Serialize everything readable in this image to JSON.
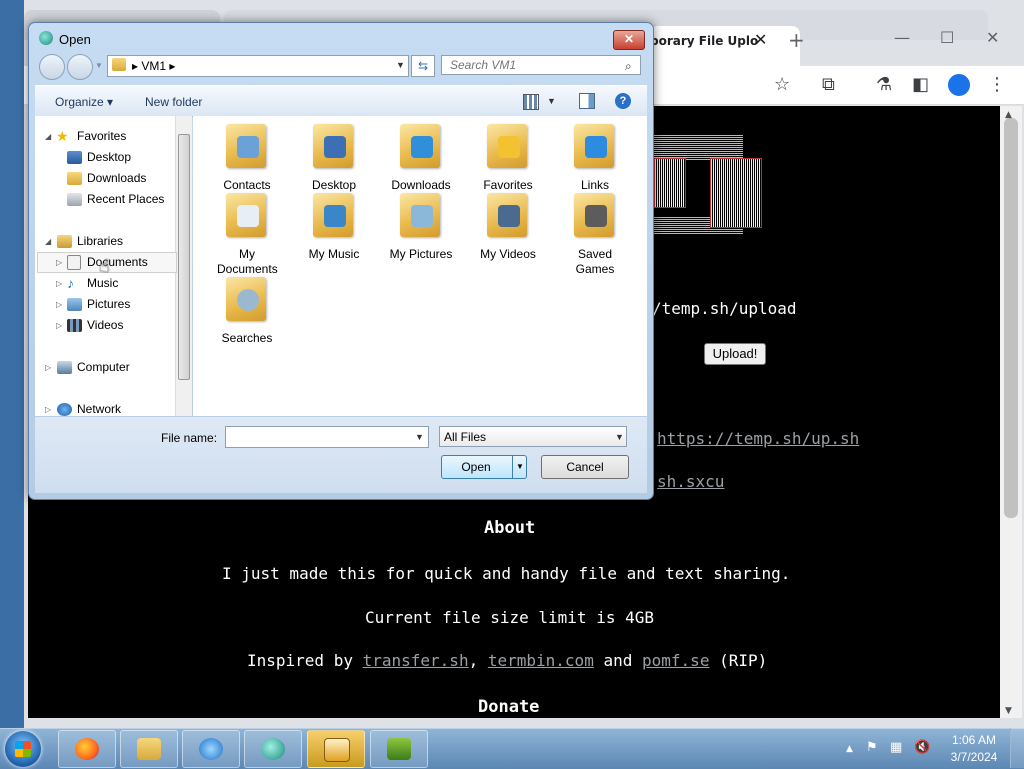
{
  "browser": {
    "tab_title": "porary File Uplo",
    "tab_close": "✕",
    "new_tab": "+",
    "min": "—",
    "max": "☐",
    "close": "✕"
  },
  "page": {
    "upload_path": "/temp.sh/upload",
    "upload_button": "Upload!",
    "script_link": "https://temp.sh/up.sh",
    "sxcu_link": "sh.sxcu",
    "about_heading": "About",
    "about_text": "I just made this for quick and handy file and text sharing.",
    "limit_text": "Current file size limit is 4GB",
    "inspired_prefix": "Inspired by",
    "link_transfer": "transfer.sh",
    "comma": ",",
    "link_termbin": "termbin.com",
    "and_text": "and",
    "link_pomf": "pomf.se",
    "rip_text": "(RIP)",
    "donate_heading": "Donate"
  },
  "dialog": {
    "title": "Open",
    "close_label": "✕",
    "address": "▸  VM1  ▸",
    "search_placeholder": "Search VM1",
    "organize": "Organize ▾",
    "new_folder": "New folder",
    "nav": {
      "favorites": "Favorites",
      "desktop": "Desktop",
      "downloads": "Downloads",
      "recent_places": "Recent Places",
      "libraries": "Libraries",
      "documents": "Documents",
      "music": "Music",
      "pictures": "Pictures",
      "videos": "Videos",
      "computer": "Computer",
      "network": "Network"
    },
    "files": [
      {
        "label": "Contacts",
        "badge": "#6aa1d8"
      },
      {
        "label": "Desktop",
        "badge": "#3d6fb5"
      },
      {
        "label": "Downloads",
        "badge": "#2f8fd8"
      },
      {
        "label": "Favorites",
        "badge": "#f2c230"
      },
      {
        "label": "Links",
        "badge": "#2d8be0"
      },
      {
        "label": "My Documents",
        "badge": "#e8eef5"
      },
      {
        "label": "My Music",
        "badge": "#3a86c8"
      },
      {
        "label": "My Pictures",
        "badge": "#8bb8d9"
      },
      {
        "label": "My Videos",
        "badge": "#4a6b8f"
      },
      {
        "label": "Saved Games",
        "badge": "#5c5c5c"
      },
      {
        "label": "Searches",
        "badge": "#9ab8d0"
      }
    ],
    "file_name_label": "File name:",
    "file_name_value": "",
    "filter": "All Files",
    "open_button": "Open",
    "cancel_button": "Cancel"
  },
  "taskbar": {
    "time": "1:06 AM",
    "date": "3/7/2024"
  }
}
